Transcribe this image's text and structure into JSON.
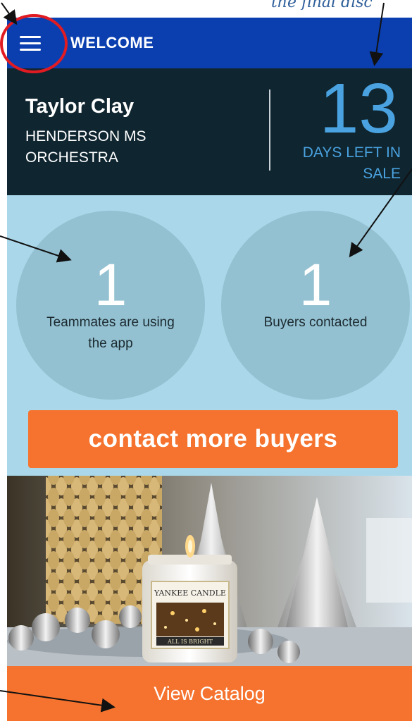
{
  "appbar": {
    "title": "WELCOME",
    "menu_icon": "hamburger-menu-icon"
  },
  "seller": {
    "name": "Taylor Clay",
    "group": "HENDERSON MS ORCHESTRA"
  },
  "countdown": {
    "days": "13",
    "label": "DAYS LEFT IN SALE"
  },
  "stats": {
    "teammates": {
      "value": "1",
      "label": "Teammates are using the app"
    },
    "buyers": {
      "value": "1",
      "label": "Buyers contacted"
    }
  },
  "cta": {
    "label": "contact more buyers"
  },
  "promo_image": {
    "brand_label": "YANKEE CANDLE",
    "product_label": "ALL IS BRIGHT"
  },
  "catalog": {
    "label": "View Catalog"
  },
  "annotation": {
    "text": "the final disc",
    "color": "#2f5f9a",
    "circle_color": "#e11b22"
  },
  "colors": {
    "appbar": "#0b3fb0",
    "header": "#0f2530",
    "accent_blue": "#4aa3e0",
    "background": "#aad8ea",
    "orange": "#f5732e"
  }
}
